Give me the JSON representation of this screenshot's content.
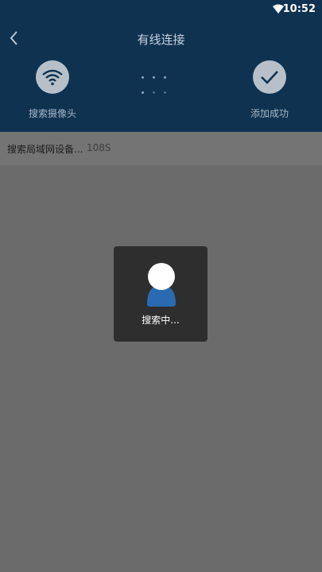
{
  "status_bar": {
    "time": "10:52",
    "wifi_icon": "wifi-icon"
  },
  "header": {
    "title": "有线连接",
    "back_icon": "chevron-left-icon",
    "steps": [
      {
        "label": "搜索摄像头",
        "icon": "wifi-icon"
      },
      {
        "label": "添加成功",
        "icon": "check-icon"
      }
    ]
  },
  "search": {
    "status_text": "搜索局域网设备...",
    "countdown": "108S"
  },
  "dialog": {
    "message": "搜索中..."
  },
  "colors": {
    "header_bg": "#0f3251",
    "step_circle": "#b7c0c9",
    "overlay": "#6b6b6b",
    "dialog_bg": "#2e2e2e",
    "spinner_blue": "#2a6ab1"
  }
}
